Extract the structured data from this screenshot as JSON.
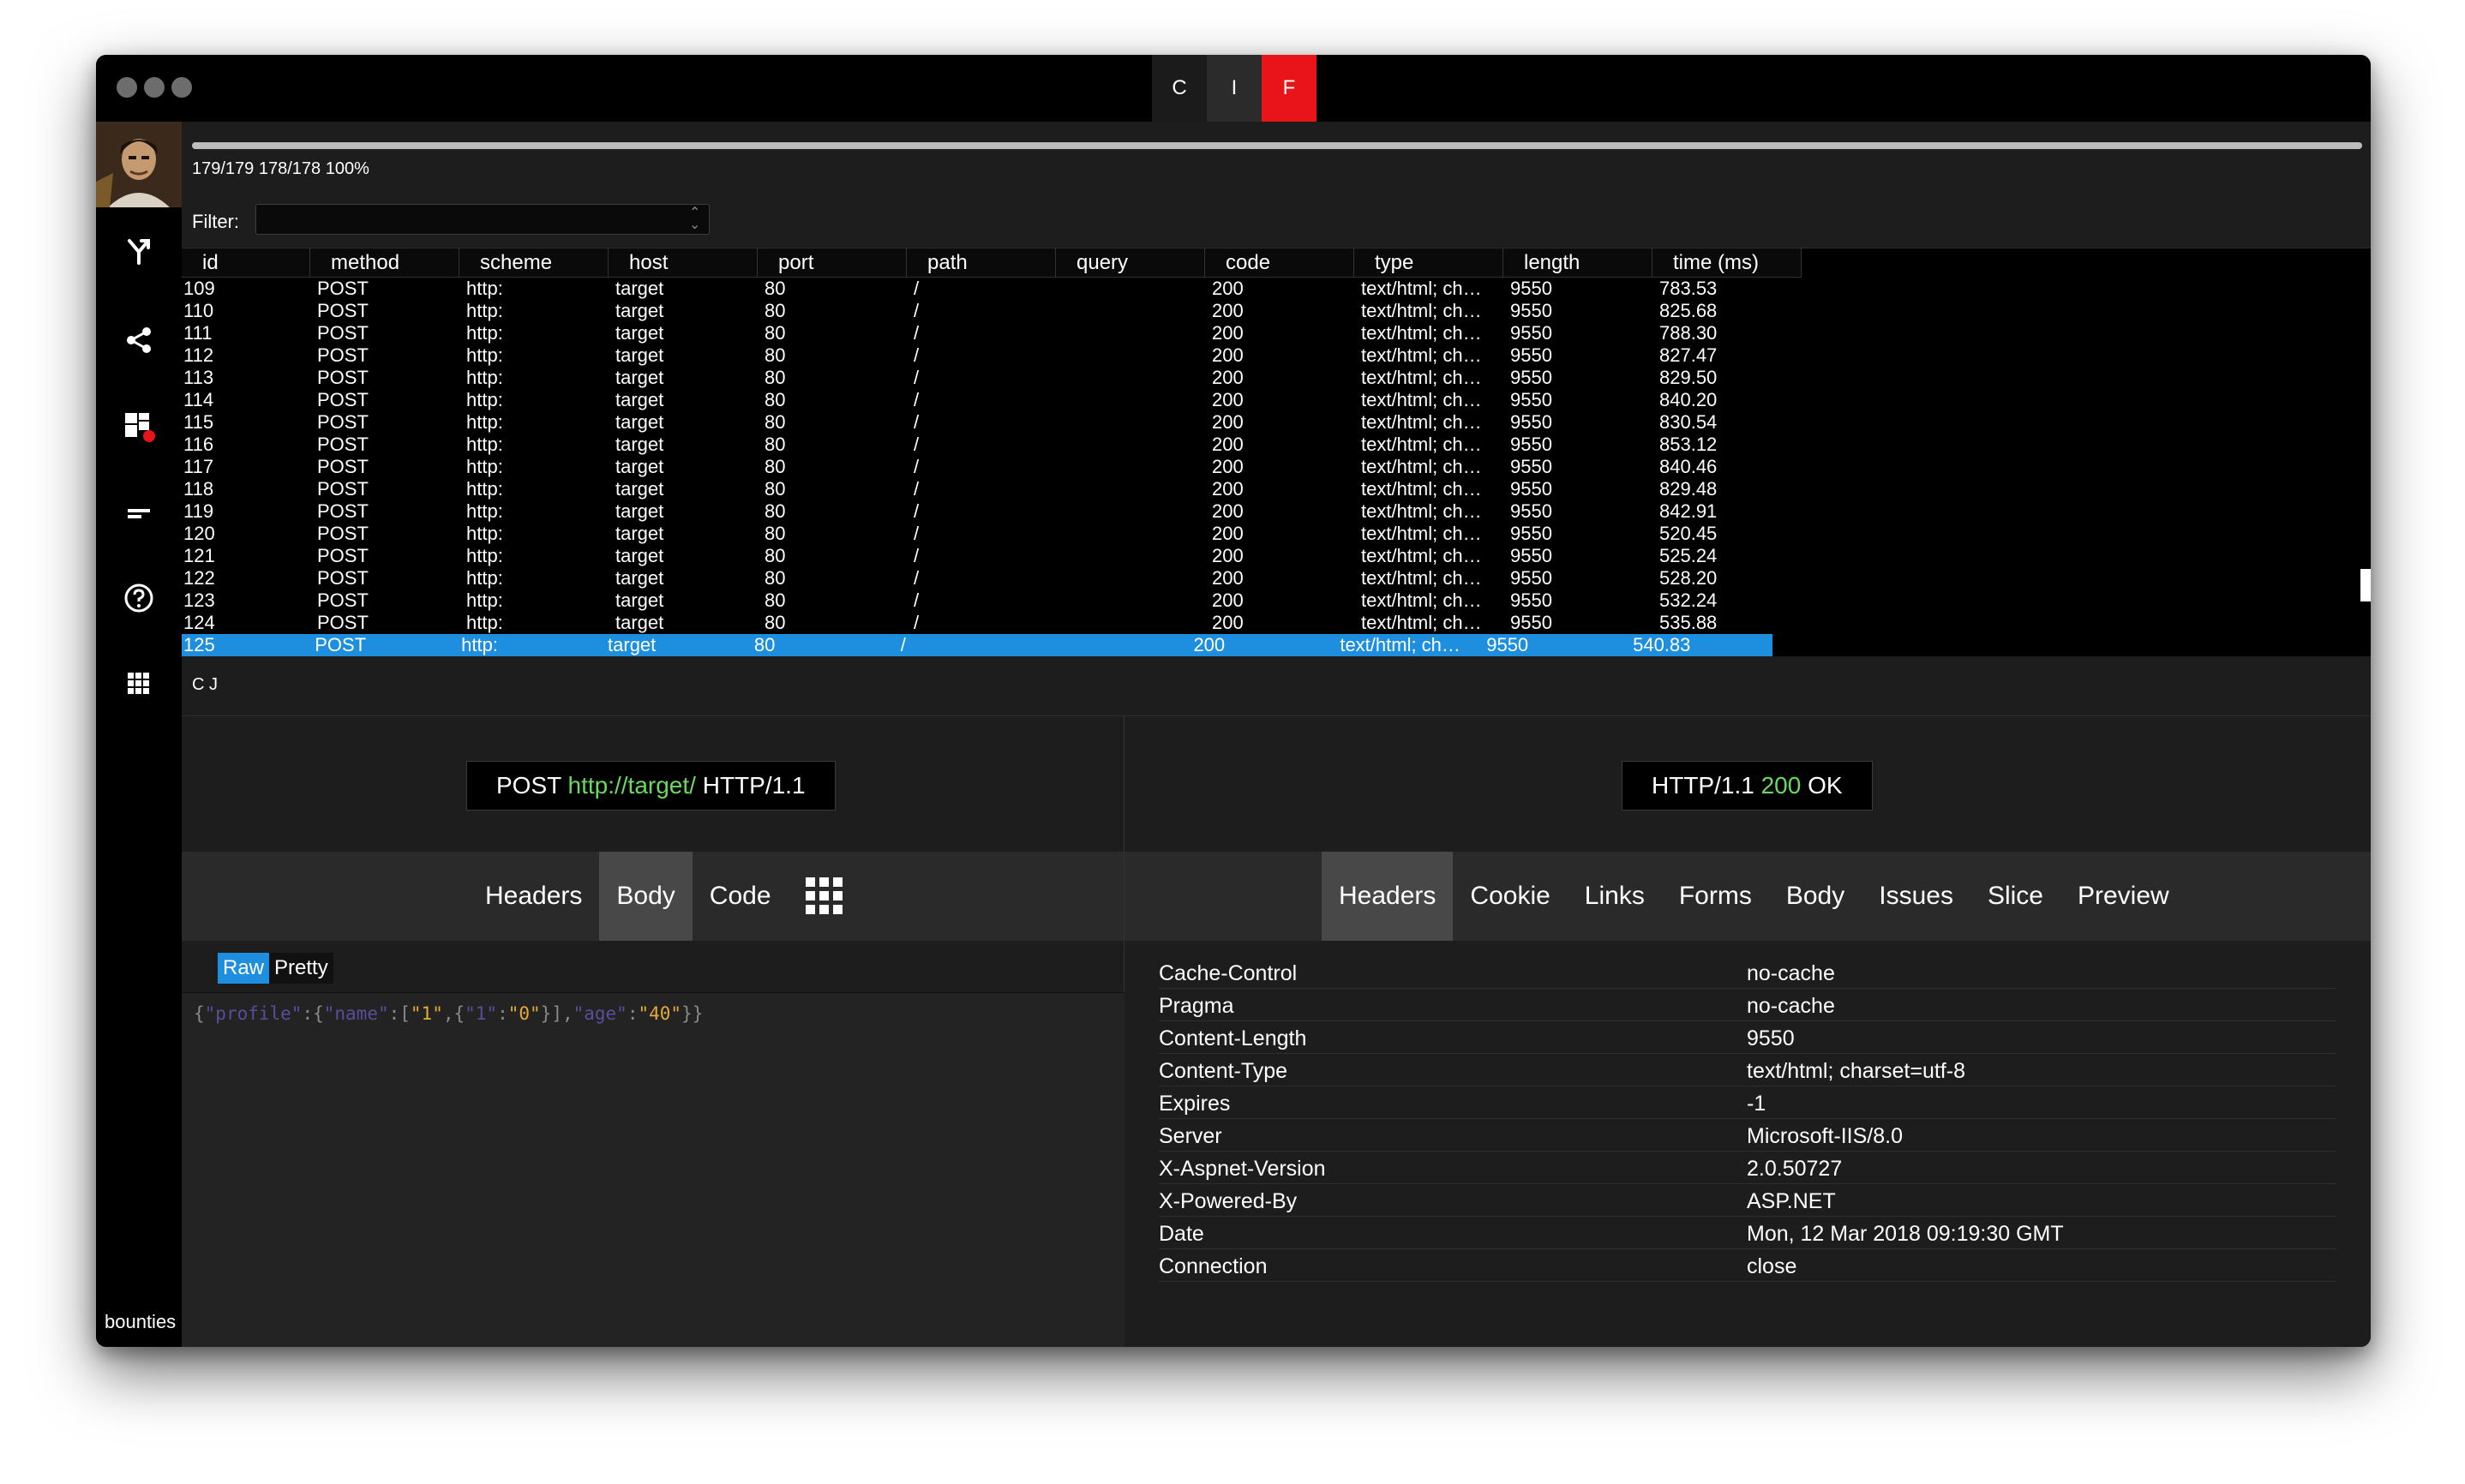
{
  "titlebar": {
    "tabs": [
      {
        "label": "C"
      },
      {
        "label": "I"
      },
      {
        "label": "F"
      }
    ]
  },
  "sidebar": {
    "icons": [
      "fork-icon",
      "share-icon",
      "dashboard-icon",
      "menu-icon",
      "help-icon",
      "apps-grid-icon"
    ],
    "badge_color": "#e8141a",
    "footer_label": "bounties"
  },
  "progress": {
    "fraction": 1.0,
    "text": "179/179 178/178 100%"
  },
  "filter": {
    "label": "Filter:",
    "value": ""
  },
  "table": {
    "columns": [
      "id",
      "method",
      "scheme",
      "host",
      "port",
      "path",
      "query",
      "code",
      "type",
      "length",
      "time (ms)"
    ],
    "rows": [
      [
        "109",
        "POST",
        "http:",
        "target",
        "80",
        "/",
        "",
        "200",
        "text/html; ch…",
        "9550",
        "783.53"
      ],
      [
        "110",
        "POST",
        "http:",
        "target",
        "80",
        "/",
        "",
        "200",
        "text/html; ch…",
        "9550",
        "825.68"
      ],
      [
        "111",
        "POST",
        "http:",
        "target",
        "80",
        "/",
        "",
        "200",
        "text/html; ch…",
        "9550",
        "788.30"
      ],
      [
        "112",
        "POST",
        "http:",
        "target",
        "80",
        "/",
        "",
        "200",
        "text/html; ch…",
        "9550",
        "827.47"
      ],
      [
        "113",
        "POST",
        "http:",
        "target",
        "80",
        "/",
        "",
        "200",
        "text/html; ch…",
        "9550",
        "829.50"
      ],
      [
        "114",
        "POST",
        "http:",
        "target",
        "80",
        "/",
        "",
        "200",
        "text/html; ch…",
        "9550",
        "840.20"
      ],
      [
        "115",
        "POST",
        "http:",
        "target",
        "80",
        "/",
        "",
        "200",
        "text/html; ch…",
        "9550",
        "830.54"
      ],
      [
        "116",
        "POST",
        "http:",
        "target",
        "80",
        "/",
        "",
        "200",
        "text/html; ch…",
        "9550",
        "853.12"
      ],
      [
        "117",
        "POST",
        "http:",
        "target",
        "80",
        "/",
        "",
        "200",
        "text/html; ch…",
        "9550",
        "840.46"
      ],
      [
        "118",
        "POST",
        "http:",
        "target",
        "80",
        "/",
        "",
        "200",
        "text/html; ch…",
        "9550",
        "829.48"
      ],
      [
        "119",
        "POST",
        "http:",
        "target",
        "80",
        "/",
        "",
        "200",
        "text/html; ch…",
        "9550",
        "842.91"
      ],
      [
        "120",
        "POST",
        "http:",
        "target",
        "80",
        "/",
        "",
        "200",
        "text/html; ch…",
        "9550",
        "520.45"
      ],
      [
        "121",
        "POST",
        "http:",
        "target",
        "80",
        "/",
        "",
        "200",
        "text/html; ch…",
        "9550",
        "525.24"
      ],
      [
        "122",
        "POST",
        "http:",
        "target",
        "80",
        "/",
        "",
        "200",
        "text/html; ch…",
        "9550",
        "528.20"
      ],
      [
        "123",
        "POST",
        "http:",
        "target",
        "80",
        "/",
        "",
        "200",
        "text/html; ch…",
        "9550",
        "532.24"
      ],
      [
        "124",
        "POST",
        "http:",
        "target",
        "80",
        "/",
        "",
        "200",
        "text/html; ch…",
        "9550",
        "535.88"
      ],
      [
        "125",
        "POST",
        "http:",
        "target",
        "80",
        "/",
        "",
        "200",
        "text/html; ch…",
        "9550",
        "540.83"
      ]
    ],
    "selected_index": 16,
    "selected_color": "#1e8fde"
  },
  "cj_buttons": [
    "C",
    "J"
  ],
  "request": {
    "method": "POST",
    "url": "http://target/",
    "protocol": "HTTP/1.1",
    "tabs": [
      "Headers",
      "Body",
      "Code"
    ],
    "active_tab": "Body",
    "view_modes": [
      "Raw",
      "Pretty"
    ],
    "active_view_mode": "Raw",
    "body_json": [
      {
        "t": "p",
        "v": "{"
      },
      {
        "t": "k",
        "v": "\"profile\""
      },
      {
        "t": "p",
        "v": ":{"
      },
      {
        "t": "k",
        "v": "\"name\""
      },
      {
        "t": "p",
        "v": ":["
      },
      {
        "t": "s",
        "v": "\"1\""
      },
      {
        "t": "p",
        "v": ",{"
      },
      {
        "t": "k",
        "v": "\"1\""
      },
      {
        "t": "p",
        "v": ":"
      },
      {
        "t": "s",
        "v": "\"0\""
      },
      {
        "t": "p",
        "v": "}],"
      },
      {
        "t": "k",
        "v": "\"age\""
      },
      {
        "t": "p",
        "v": ":"
      },
      {
        "t": "s",
        "v": "\"40\""
      },
      {
        "t": "p",
        "v": "}}"
      }
    ]
  },
  "response": {
    "protocol": "HTTP/1.1",
    "status_code": "200",
    "status_text": "OK",
    "tabs": [
      "Headers",
      "Cookie",
      "Links",
      "Forms",
      "Body",
      "Issues",
      "Slice",
      "Preview"
    ],
    "active_tab": "Headers",
    "headers": [
      [
        "Cache-Control",
        "no-cache"
      ],
      [
        "Pragma",
        "no-cache"
      ],
      [
        "Content-Length",
        "9550"
      ],
      [
        "Content-Type",
        "text/html; charset=utf-8"
      ],
      [
        "Expires",
        "-1"
      ],
      [
        "Server",
        "Microsoft-IIS/8.0"
      ],
      [
        "X-Aspnet-Version",
        "2.0.50727"
      ],
      [
        "X-Powered-By",
        "ASP.NET"
      ],
      [
        "Date",
        "Mon, 12 Mar 2018 09:19:30 GMT"
      ],
      [
        "Connection",
        "close"
      ]
    ]
  },
  "colors": {
    "accent_blue": "#1e8fde",
    "accent_red": "#e8141a",
    "url_green": "#6bd85f"
  }
}
